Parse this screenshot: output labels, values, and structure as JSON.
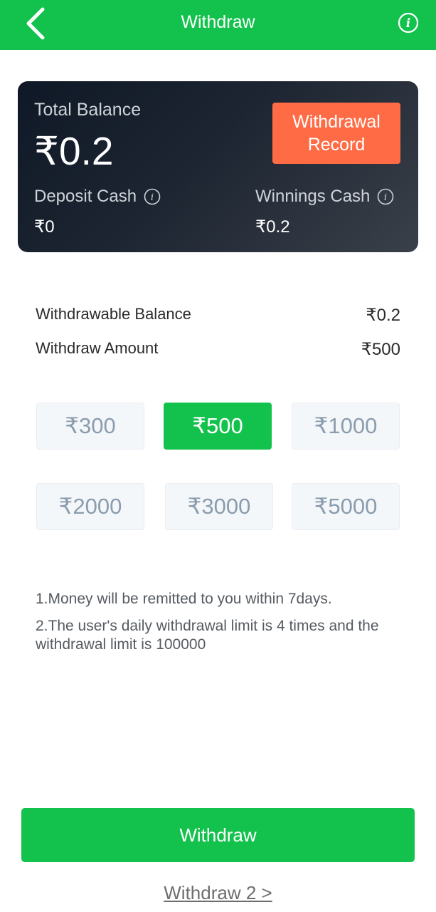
{
  "header": {
    "title": "Withdraw"
  },
  "card": {
    "total_label": "Total Balance",
    "total_value": "₹0.2",
    "record_button": "Withdrawal\nRecord",
    "deposit_label": "Deposit Cash",
    "deposit_value": "₹0",
    "winnings_label": "Winnings Cash",
    "winnings_value": "₹0.2"
  },
  "summary": {
    "withdrawable_label": "Withdrawable Balance",
    "withdrawable_value": "₹0.2",
    "amount_label": "Withdraw Amount",
    "amount_value": "₹500"
  },
  "amounts": [
    "₹300",
    "₹500",
    "₹1000",
    "₹2000",
    "₹3000",
    "₹5000"
  ],
  "notes": [
    "1.Money will be remitted to you within 7days.",
    "2.The user's daily withdrawal limit is 4 times and the withdrawal limit is 100000"
  ],
  "actions": {
    "withdraw": "Withdraw",
    "withdraw2": "Withdraw 2 >"
  },
  "colors": {
    "brand_green": "#13c24c",
    "accent_orange": "#ff6b45",
    "card_dark": "#1d2532"
  }
}
